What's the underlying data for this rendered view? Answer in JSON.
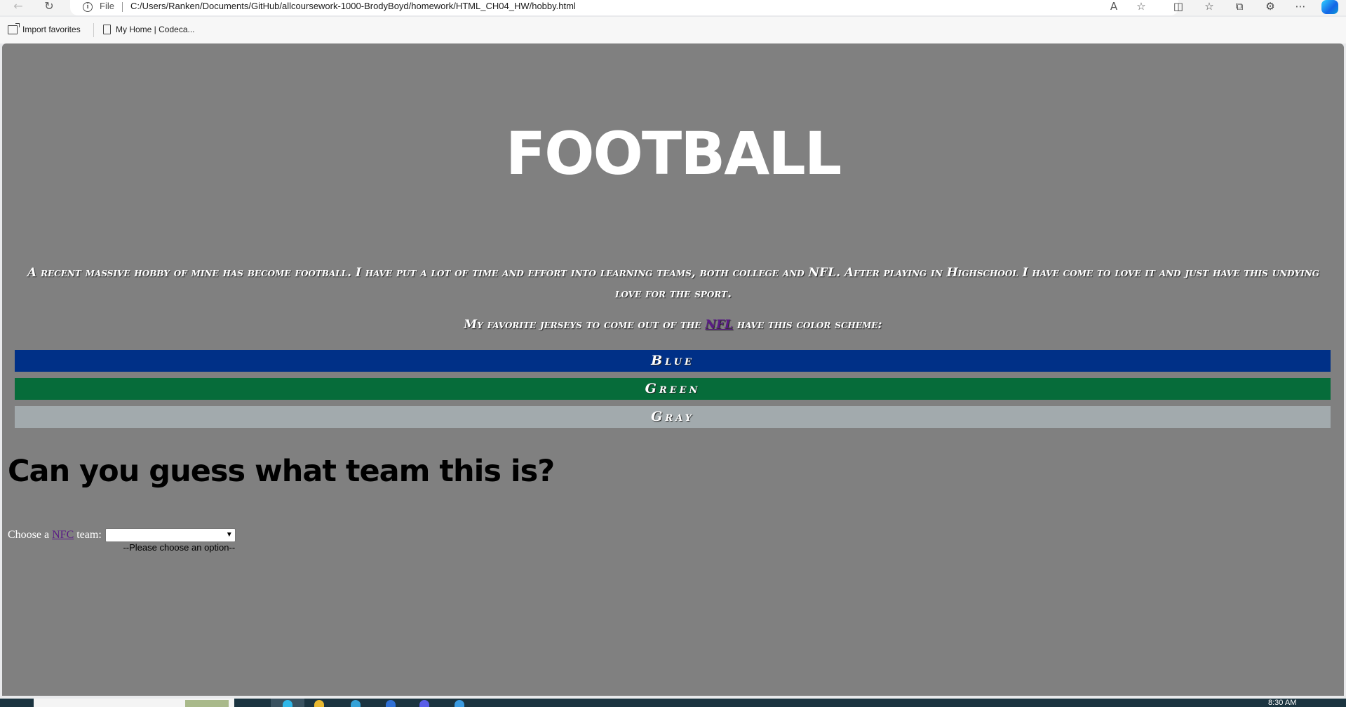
{
  "browser": {
    "file_label": "File",
    "url": "C:/Users/Ranken/Documents/GitHub/allcoursework-1000-BrodyBoyd/homework/HTML_CH04_HW/hobby.html",
    "favorites": [
      "Import favorites",
      "My Home | Codeca..."
    ]
  },
  "page": {
    "title": "FOOTBALL",
    "intro": "A recent massive hobby of mine has become football. I have put a lot of time and effort into learning teams, both college and NFL. After playing in Highschool I have come to love it and just have this undying love for the sport.",
    "jersey_prefix": "My favorite jerseys to come out of the ",
    "jersey_link": "NFL",
    "jersey_suffix": " have this color scheme:",
    "colors": [
      {
        "label": "Blue",
        "hex": "#003087"
      },
      {
        "label": "Green",
        "hex": "#066c3a"
      },
      {
        "label": "Gray",
        "hex": "#a2aaad"
      }
    ],
    "guess_heading": "Can you guess what team this is?",
    "choose_prefix": "Choose a ",
    "choose_link": "NFC",
    "choose_suffix": " team:",
    "select_value": "--Please choose an option--"
  },
  "taskbar": {
    "time": "8:30 AM"
  }
}
